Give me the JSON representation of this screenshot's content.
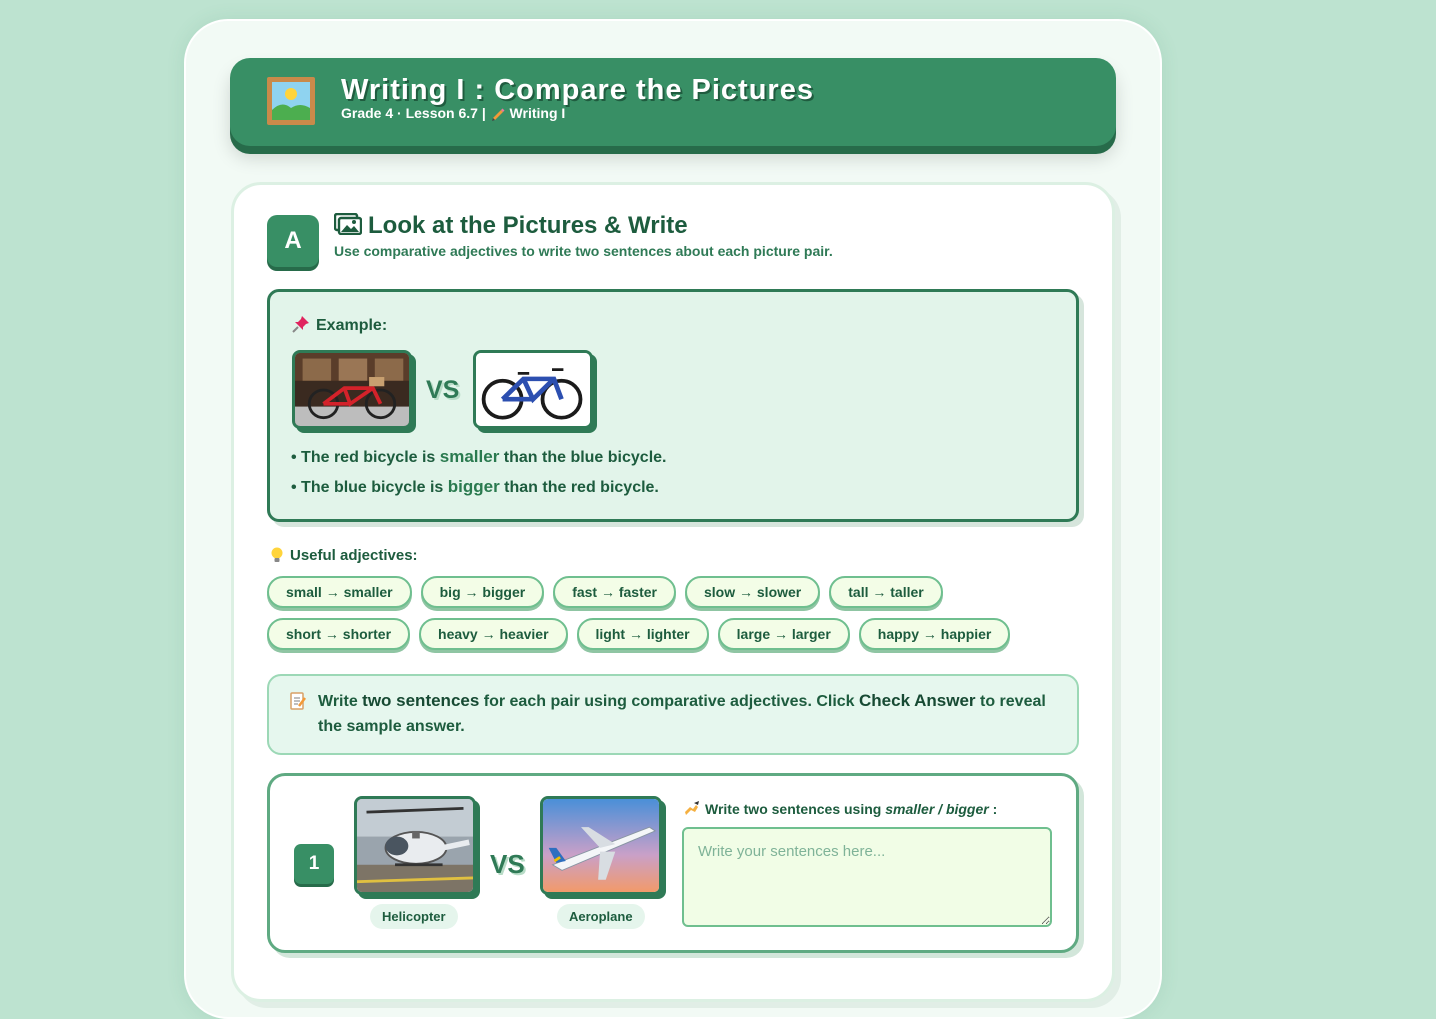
{
  "header": {
    "title": "Writing I : Compare the Pictures",
    "subtitle_prefix": "Grade 4 · Lesson 6.7  |",
    "subtitle_suffix": "Writing I"
  },
  "section": {
    "badge": "A",
    "title": "Look at the Pictures & Write",
    "subtitle": "Use comparative adjectives to write two sentences about each picture pair."
  },
  "example": {
    "label": "Example:",
    "vs": "VS",
    "line1": {
      "before": "• The red bicycle is ",
      "bold": "smaller",
      "after": " than the blue bicycle."
    },
    "line2": {
      "before": "• The blue bicycle is ",
      "bold": "bigger",
      "after": " than the red bicycle."
    }
  },
  "adjectives": {
    "label": "Useful adjectives:",
    "row1": [
      "small → smaller",
      "big → bigger",
      "fast → faster",
      "slow → slower",
      "tall → taller"
    ],
    "row2": [
      "short → shorter",
      "heavy → heavier",
      "light → lighter",
      "large → larger",
      "happy → happier"
    ]
  },
  "instructions": {
    "t1": "Write ",
    "b1": "two sentences",
    "t2": " for each pair using comparative adjectives. Click ",
    "b2": "Check Answer",
    "t3": " to reveal the sample answer."
  },
  "question1": {
    "number": "1",
    "vs": "VS",
    "left_caption": "Helicopter",
    "right_caption": "Aeroplane",
    "label_prefix": "Write two sentences using ",
    "label_words": "smaller / bigger",
    "label_suffix": " :",
    "placeholder": "Write your sentences here..."
  },
  "colors": {
    "primary": "#388f65",
    "primary_dark": "#276b4a",
    "background": "#bde3d0",
    "chip_bg": "#f3fde7"
  },
  "icons": [
    "picture-frame-icon",
    "pencil-icon",
    "images-icon",
    "pushpin-icon",
    "lightbulb-icon",
    "memo-icon",
    "writing-hand-icon"
  ]
}
